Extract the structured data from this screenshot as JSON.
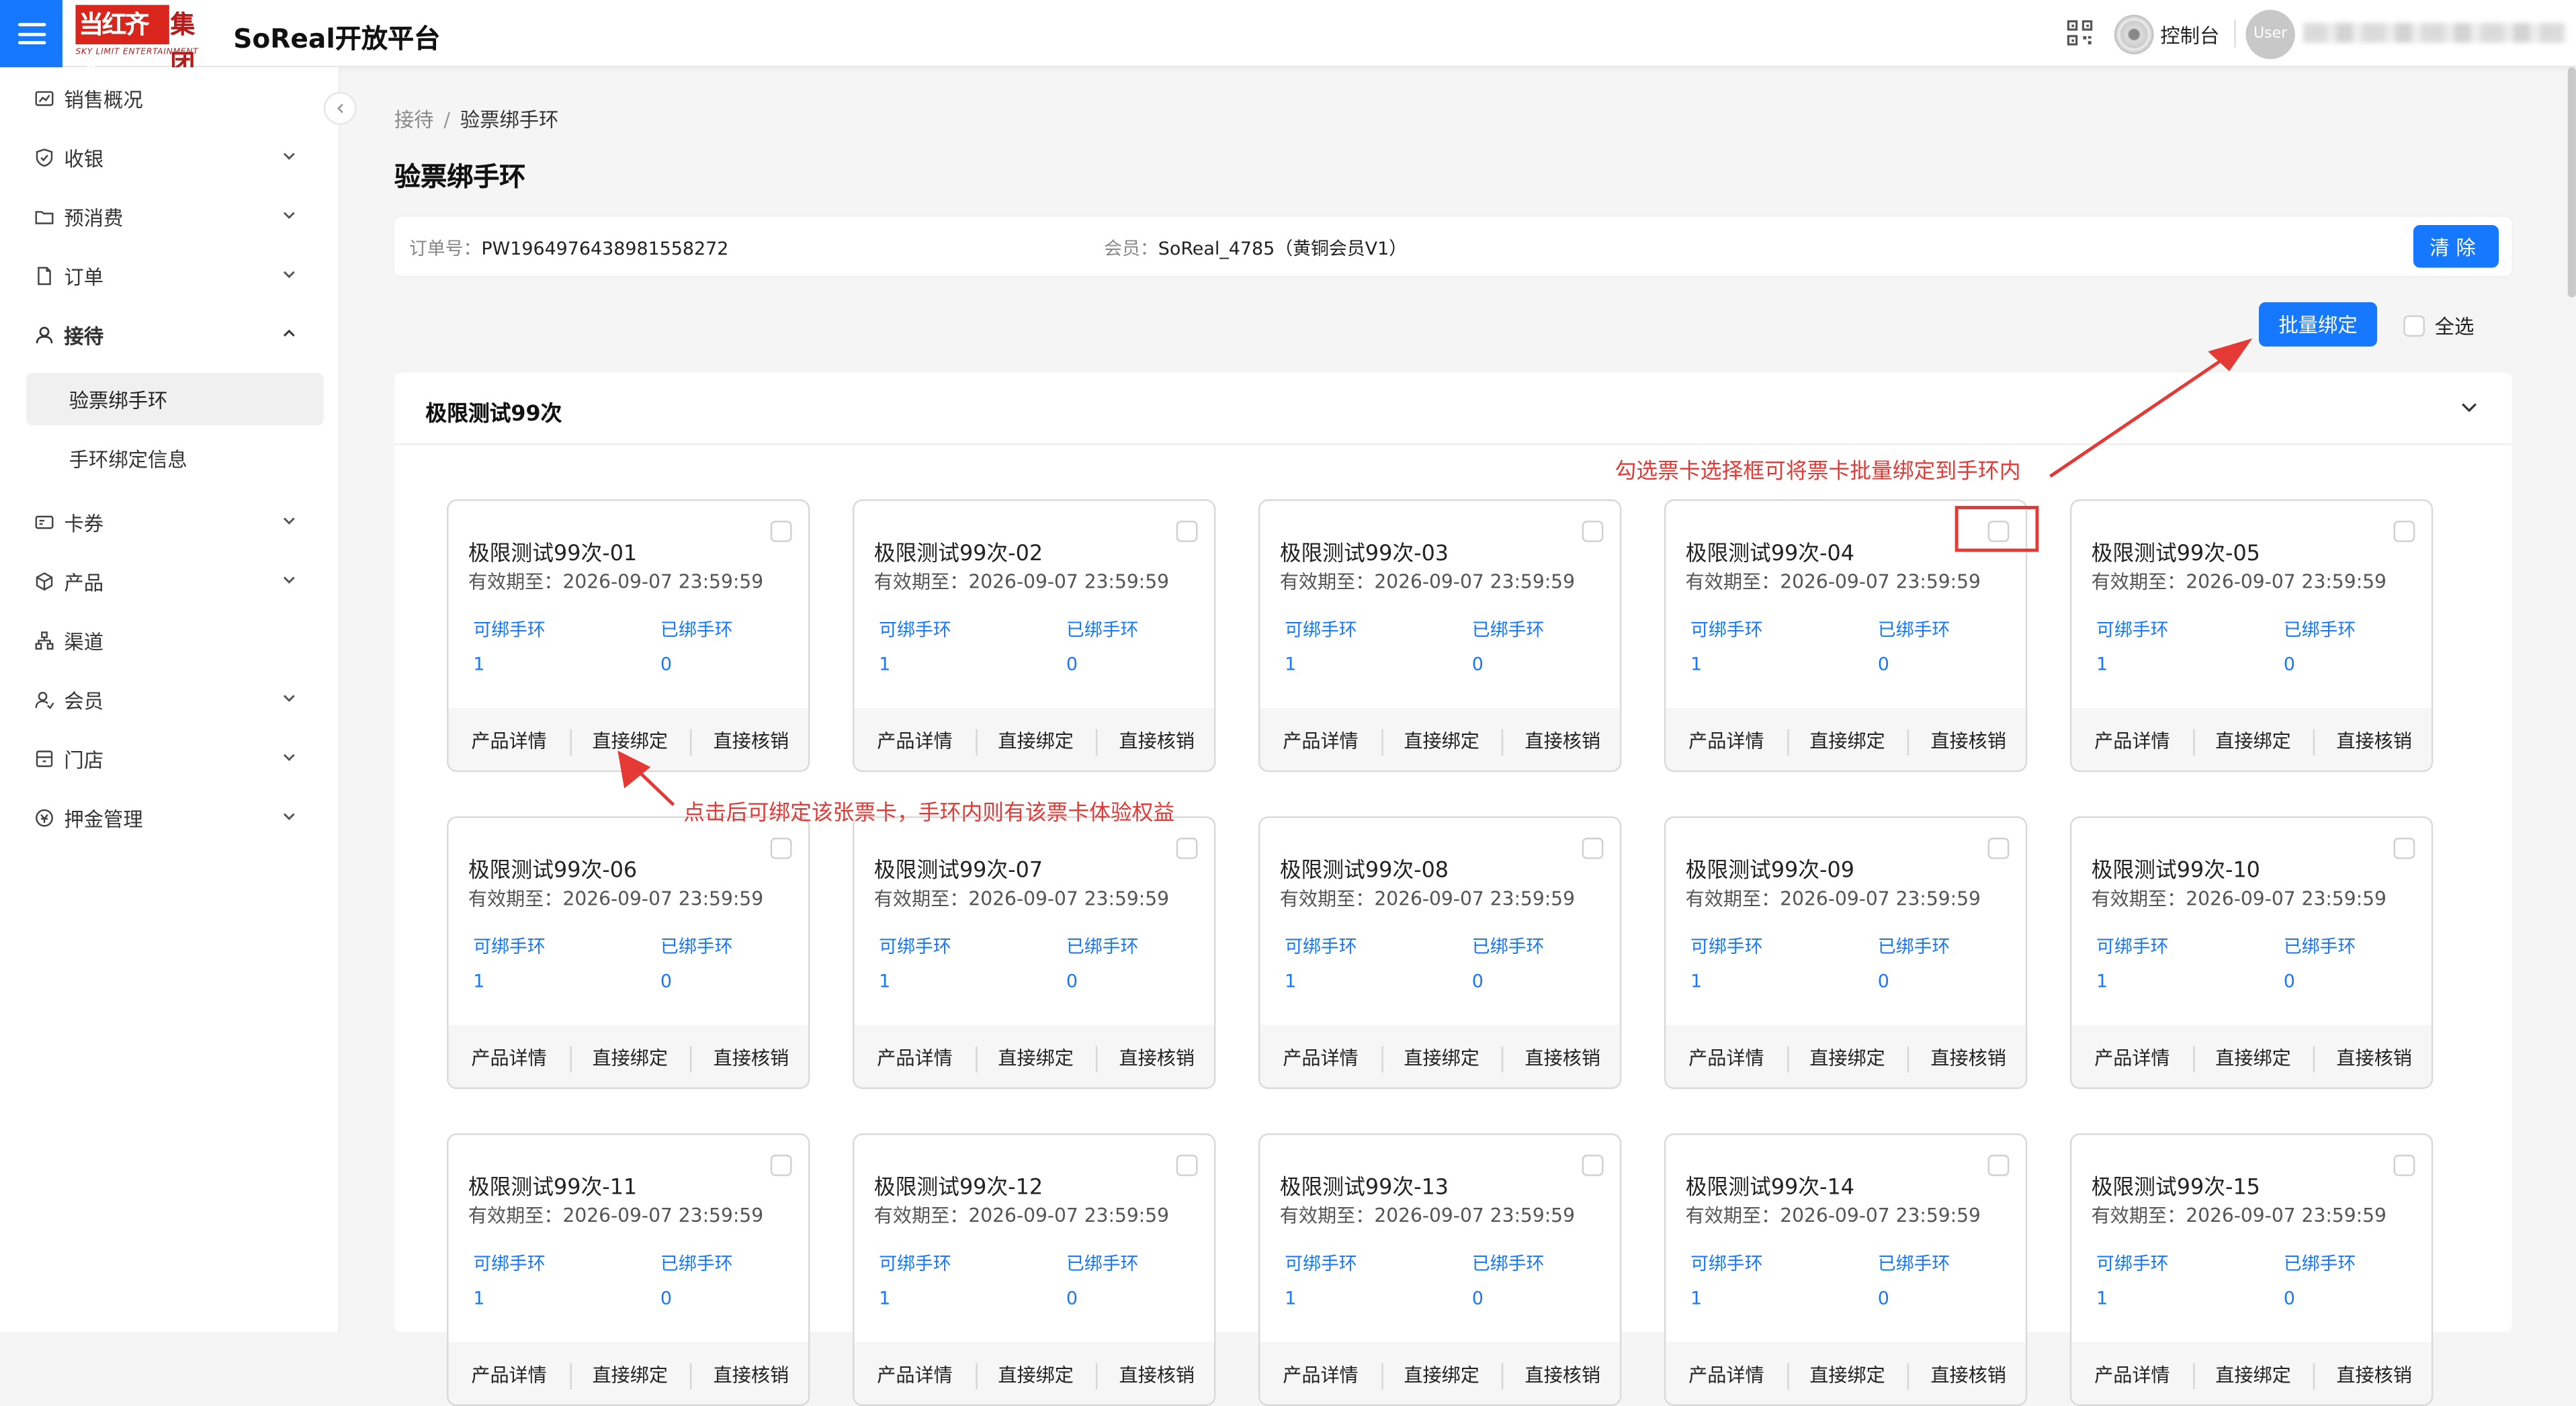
{
  "header": {
    "logo_main": "当红齐天",
    "logo_suffix": "集团",
    "logo_sub": "SKY LIMIT ENTERTAINMENT",
    "app_title": "SoReal开放平台",
    "console_label": "控制台",
    "avatar_text": "User"
  },
  "sidebar": {
    "items": [
      {
        "label": "销售概况",
        "icon": "chart-icon"
      },
      {
        "label": "收银",
        "icon": "shield-icon"
      },
      {
        "label": "预消费",
        "icon": "folder-icon"
      },
      {
        "label": "订单",
        "icon": "file-icon"
      },
      {
        "label": "接待",
        "icon": "user-icon"
      },
      {
        "label": "卡券",
        "icon": "card-icon"
      },
      {
        "label": "产品",
        "icon": "cube-icon"
      },
      {
        "label": "渠道",
        "icon": "channel-icon"
      },
      {
        "label": "会员",
        "icon": "member-icon"
      },
      {
        "label": "门店",
        "icon": "store-icon"
      },
      {
        "label": "押金管理",
        "icon": "deposit-icon"
      }
    ],
    "sub_items": [
      {
        "label": "验票绑手环",
        "active": true
      },
      {
        "label": "手环绑定信息",
        "active": false
      }
    ]
  },
  "breadcrumb": {
    "parent": "接待",
    "separator": "/",
    "current": "验票绑手环"
  },
  "page_title": "验票绑手环",
  "order": {
    "order_label": "订单号：",
    "order_no": "PW1964976438981558272",
    "member_label": "会员：",
    "member": "SoReal_4785（黄铜会员V1）",
    "clear_label": "清除"
  },
  "batch_bind_label": "批量绑定",
  "select_all_label": "全选",
  "panel": {
    "title": "极限测试99次"
  },
  "card_common": {
    "valid_label": "有效期至：",
    "valid_date": "2026-09-07 23:59:59",
    "bindable_label": "可绑手环",
    "bound_label": "已绑手环",
    "bindable_value": "1",
    "bound_value": "0",
    "action_detail": "产品详情",
    "action_bind": "直接绑定",
    "action_verify": "直接核销"
  },
  "cards": [
    {
      "name": "极限测试99次-01"
    },
    {
      "name": "极限测试99次-02"
    },
    {
      "name": "极限测试99次-03"
    },
    {
      "name": "极限测试99次-04"
    },
    {
      "name": "极限测试99次-05"
    },
    {
      "name": "极限测试99次-06"
    },
    {
      "name": "极限测试99次-07"
    },
    {
      "name": "极限测试99次-08"
    },
    {
      "name": "极限测试99次-09"
    },
    {
      "name": "极限测试99次-10"
    },
    {
      "name": "极限测试99次-11"
    },
    {
      "name": "极限测试99次-12"
    },
    {
      "name": "极限测试99次-13"
    },
    {
      "name": "极限测试99次-14"
    },
    {
      "name": "极限测试99次-15"
    }
  ],
  "annotations": {
    "checkbox_hint": "勾选票卡选择框可将票卡批量绑定到手环内",
    "bind_hint": "点击后可绑定该张票卡，手环内则有该票卡体验权益"
  },
  "colors": {
    "primary": "#1677ff",
    "annotation": "#e53935"
  }
}
